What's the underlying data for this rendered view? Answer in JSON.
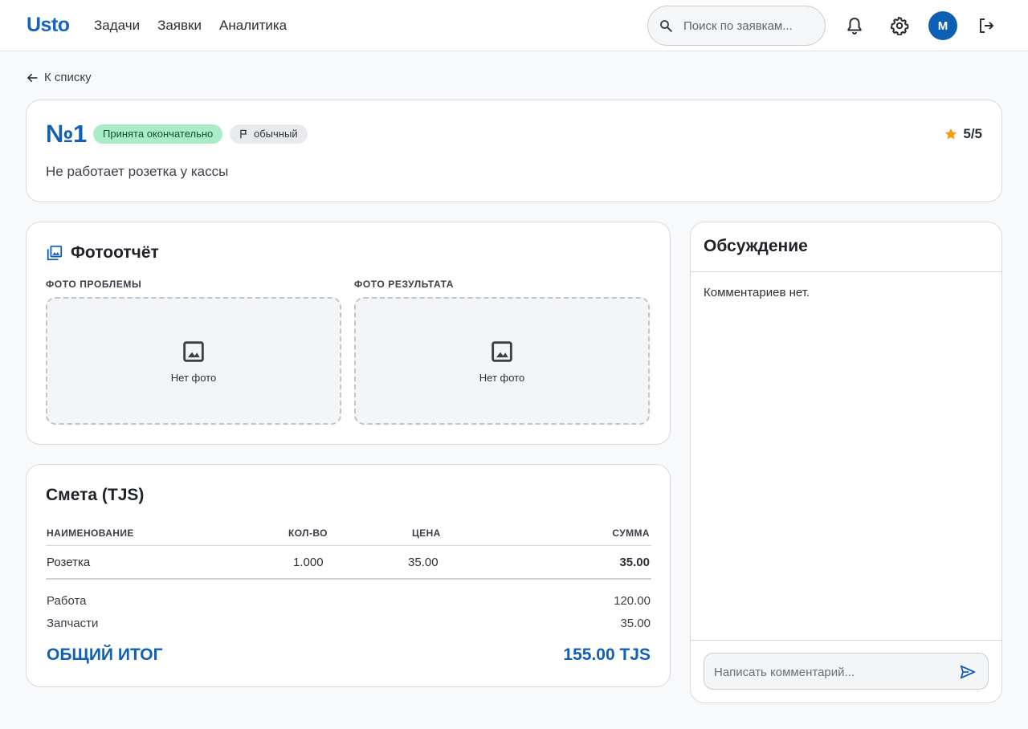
{
  "header": {
    "logo": "Usto",
    "nav": [
      "Задачи",
      "Заявки",
      "Аналитика"
    ],
    "search_placeholder": "Поиск по заявкам...",
    "avatar_initial": "M",
    "icons": [
      "search-icon",
      "bell-icon",
      "gear-icon",
      "logout-icon"
    ],
    "accent_color": "#1565c0"
  },
  "back_link": "К списку",
  "ticket": {
    "number": "№1",
    "status": "Принята окончательно",
    "priority": "обычный",
    "rating": "5/5",
    "description": "Не работает розетка у кассы"
  },
  "photos": {
    "title": "Фотоотчёт",
    "problem_label": "ФОТО ПРОБЛЕМЫ",
    "result_label": "ФОТО РЕЗУЛЬТАТА",
    "no_photo": "Нет фото"
  },
  "estimate": {
    "title": "Смета (TJS)",
    "columns": [
      "НАИМЕНОВАНИЕ",
      "КОЛ-ВО",
      "ЦЕНА",
      "СУММА"
    ],
    "rows": [
      {
        "name": "Розетка",
        "qty": "1.000",
        "price": "35.00",
        "sum": "35.00"
      }
    ],
    "work_label": "Работа",
    "work_value": "120.00",
    "parts_label": "Запчасти",
    "parts_value": "35.00",
    "total_label": "ОБЩИЙ ИТОГ",
    "total_value": "155.00 TJS"
  },
  "discussion": {
    "title": "Обсуждение",
    "empty": "Комментариев нет.",
    "input_placeholder": "Написать комментарий..."
  }
}
